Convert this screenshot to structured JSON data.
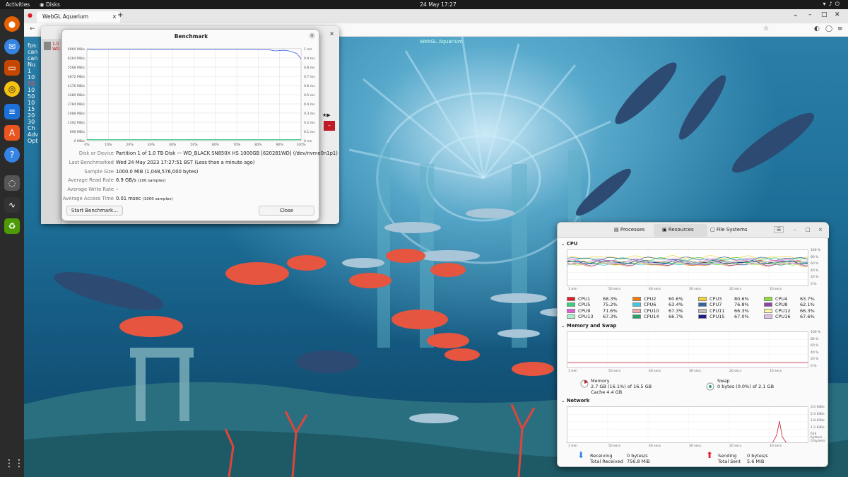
{
  "topbar": {
    "activities": "Activities",
    "app": "Disks",
    "clock": "24 May  17:27"
  },
  "browser": {
    "tab_title": "WebGL Aquarium",
    "tab_close": "×",
    "new_tab": "+"
  },
  "aquarium": {
    "title": "WebGL Aquarium",
    "overlay": [
      "fps:",
      "can",
      "can",
      "Nu",
      "1",
      "10",
      "50",
      "10",
      "50",
      "10",
      "15",
      "20",
      "30",
      "Ch",
      "Adv",
      "Opt"
    ]
  },
  "disks_window": {
    "close": "×",
    "disk_label_1": "1.0",
    "disk_label_2": "WD"
  },
  "benchmark": {
    "title": "Benchmark",
    "close": "×",
    "chart_data": {
      "type": "line",
      "y_left_ticks": [
        "6960 MB/s",
        "6264 MB/s",
        "5568 MB/s",
        "4872 MB/s",
        "4176 MB/s",
        "3480 MB/s",
        "2784 MB/s",
        "2088 MB/s",
        "1392 MB/s",
        "696 MB/s",
        "0 MB/s"
      ],
      "y_right_ticks": [
        "1 ms",
        "0.9 ms",
        "0.8 ms",
        "0.7 ms",
        "0.6 ms",
        "0.5 ms",
        "0.4 ms",
        "0.3 ms",
        "0.2 ms",
        "0.1 ms",
        "0 ms"
      ],
      "x_ticks": [
        "0%",
        "10%",
        "20%",
        "30%",
        "40%",
        "50%",
        "60%",
        "70%",
        "80%",
        "90%",
        "100%"
      ],
      "ylim_left": [
        0,
        6960
      ],
      "ylim_right": [
        0,
        1
      ],
      "read_rate": {
        "x": [
          0,
          5,
          10,
          20,
          30,
          40,
          50,
          60,
          70,
          80,
          85,
          88,
          92,
          95,
          98,
          100
        ],
        "y": [
          6920,
          6880,
          6900,
          6900,
          6900,
          6900,
          6900,
          6900,
          6900,
          6900,
          6880,
          6800,
          6850,
          6780,
          6600,
          6200
        ]
      },
      "access_time": {
        "x": [
          0,
          10,
          20,
          30,
          40,
          50,
          60,
          70,
          80,
          90,
          100
        ],
        "y": [
          0.01,
          0.01,
          0.01,
          0.01,
          0.01,
          0.01,
          0.01,
          0.01,
          0.01,
          0.01,
          0.01
        ]
      }
    },
    "props": [
      {
        "k": "Disk or Device",
        "v": "Partition 1 of 1.0 TB Disk — WD_BLACK SN850X HS 1000GB [620281WD] (/dev/nvme0n1p1)",
        "note": ""
      },
      {
        "k": "Last Benchmarked",
        "v": "Wed 24 May 2023 17:27:51 BST (Less than a minute ago)",
        "note": ""
      },
      {
        "k": "Sample Size",
        "v": "1000.0 MiB (1,048,576,000 bytes)",
        "note": ""
      },
      {
        "k": "Average Read Rate",
        "v": "6.9 GB/s",
        "note": "(100 samples)"
      },
      {
        "k": "Average Write Rate",
        "v": "–",
        "note": ""
      },
      {
        "k": "Average Access Time",
        "v": "0.01 msec",
        "note": "(1000 samples)"
      }
    ],
    "start_button": "Start Benchmark…",
    "close_button": "Close"
  },
  "sysmon": {
    "tabs": {
      "processes": "Processes",
      "resources": "Resources",
      "filesystems": "File Systems"
    },
    "menu": "☰",
    "minimize": "–",
    "maximize": "□",
    "close": "×",
    "cpu_title": "CPU",
    "percent_ticks": [
      "100 %",
      "80 %",
      "60 %",
      "40 %",
      "20 %",
      "0 %"
    ],
    "time_ticks": [
      "1 min",
      "50 secs",
      "40 secs",
      "30 secs",
      "20 secs",
      "10 secs"
    ],
    "cpus": [
      {
        "name": "CPU1",
        "pct": "68.3%",
        "color": "#e01b24"
      },
      {
        "name": "CPU2",
        "pct": "60.6%",
        "color": "#f57900"
      },
      {
        "name": "CPU3",
        "pct": "80.6%",
        "color": "#f6d32d"
      },
      {
        "name": "CPU4",
        "pct": "63.7%",
        "color": "#8ae234"
      },
      {
        "name": "CPU5",
        "pct": "75.2%",
        "color": "#33d17a"
      },
      {
        "name": "CPU6",
        "pct": "63.4%",
        "color": "#3dc6e6"
      },
      {
        "name": "CPU7",
        "pct": "76.8%",
        "color": "#3465a4"
      },
      {
        "name": "CPU8",
        "pct": "62.1%",
        "color": "#9141ac"
      },
      {
        "name": "CPU9",
        "pct": "71.6%",
        "color": "#e35bd0"
      },
      {
        "name": "CPU10",
        "pct": "67.3%",
        "color": "#f0a8a8"
      },
      {
        "name": "CPU11",
        "pct": "66.3%",
        "color": "#c0bfbc"
      },
      {
        "name": "CPU12",
        "pct": "66.3%",
        "color": "#fff6a8"
      },
      {
        "name": "CPU13",
        "pct": "67.3%",
        "color": "#a8f0c8"
      },
      {
        "name": "CPU14",
        "pct": "66.7%",
        "color": "#26a269"
      },
      {
        "name": "CPU15",
        "pct": "67.0%",
        "color": "#1c1c8c"
      },
      {
        "name": "CPU16",
        "pct": "67.6%",
        "color": "#dcbfe8"
      }
    ],
    "mem_title": "Memory and Swap",
    "memory": {
      "label": "Memory",
      "value": "2.7 GB (16.1%) of 16.5 GB",
      "cache": "Cache 4.4 GB"
    },
    "swap": {
      "label": "Swap",
      "value": "0 bytes (0.0%) of 2.1 GB"
    },
    "net_title": "Network",
    "net_ticks": [
      "3.0 KiB/s",
      "2.4 KiB/s",
      "1.8 KiB/s",
      "1.2 KiB/s",
      "614 bytes/s",
      "0 bytes/s"
    ],
    "network": {
      "receiving_label": "Receiving",
      "receiving": "0 bytes/s",
      "total_received_label": "Total Received",
      "total_received": "756.8 MiB",
      "sending_label": "Sending",
      "sending": "0 bytes/s",
      "total_sent_label": "Total Sent",
      "total_sent": "5.6 MiB"
    }
  }
}
